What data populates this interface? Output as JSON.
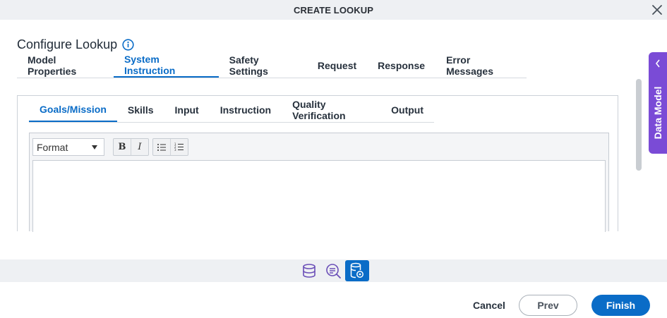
{
  "dialog": {
    "title": "CREATE LOOKUP"
  },
  "page": {
    "title": "Configure Lookup"
  },
  "tabs": [
    {
      "label": "Model Properties",
      "active": false
    },
    {
      "label": "System Instruction",
      "active": true
    },
    {
      "label": "Safety Settings",
      "active": false
    },
    {
      "label": "Request",
      "active": false
    },
    {
      "label": "Response",
      "active": false
    },
    {
      "label": "Error Messages",
      "active": false
    }
  ],
  "subtabs": [
    {
      "label": "Goals/Mission",
      "active": true
    },
    {
      "label": "Skills",
      "active": false
    },
    {
      "label": "Input",
      "active": false
    },
    {
      "label": "Instruction",
      "active": false
    },
    {
      "label": "Quality Verification",
      "active": false
    },
    {
      "label": "Output",
      "active": false
    }
  ],
  "editor": {
    "format_label": "Format",
    "bold_label": "B",
    "italic_label": "I",
    "content": ""
  },
  "side_panel": {
    "label": "Data Model"
  },
  "footer": {
    "cancel": "Cancel",
    "prev": "Prev",
    "finish": "Finish"
  },
  "colors": {
    "accent": "#0a6cc7",
    "side_panel": "#7a4bd6",
    "icon_purple": "#6b4fb8"
  }
}
